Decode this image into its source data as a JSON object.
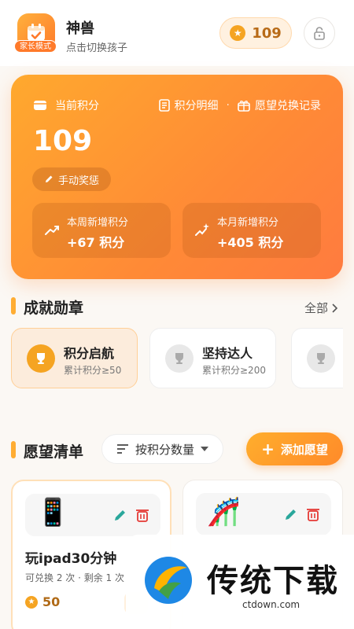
{
  "header": {
    "avatar_badge": "家长模式",
    "child_name": "神兽",
    "child_sub": "点击切换孩子",
    "points": "109"
  },
  "points_card": {
    "label": "当前积分",
    "link_detail": "积分明细",
    "link_dot": "·",
    "link_wish_log": "愿望兑换记录",
    "value": "109",
    "manual_button": "手动奖惩",
    "week_title": "本周新增积分",
    "week_value": "+67 积分",
    "month_title": "本月新增积分",
    "month_value": "+405 积分"
  },
  "achievements": {
    "title": "成就勋章",
    "see_all": "全部",
    "badges": [
      {
        "name": "积分启航",
        "desc": "累计积分≥50",
        "active": true
      },
      {
        "name": "坚持达人",
        "desc": "累计积分≥200",
        "active": false
      },
      {
        "name": "",
        "desc": "",
        "active": false
      }
    ]
  },
  "wishlist": {
    "title": "愿望清单",
    "sort_label": "按积分数量",
    "add_label": "添加愿望",
    "items": [
      {
        "emoji": "📱",
        "title": "玩ipad30分钟",
        "meta": "可兑换 2 次 · 剩余 1 次",
        "cost": "50"
      },
      {
        "emoji": "🎢",
        "title": "",
        "meta": "",
        "cost": ""
      }
    ]
  },
  "watermark": {
    "text": "传统下载",
    "url": "ctdown.com"
  },
  "colors": {
    "accent": "#ff8a36",
    "accent_light": "#ffad33",
    "coin": "#f5a422",
    "danger": "#e53935",
    "edit": "#2aa79b"
  }
}
